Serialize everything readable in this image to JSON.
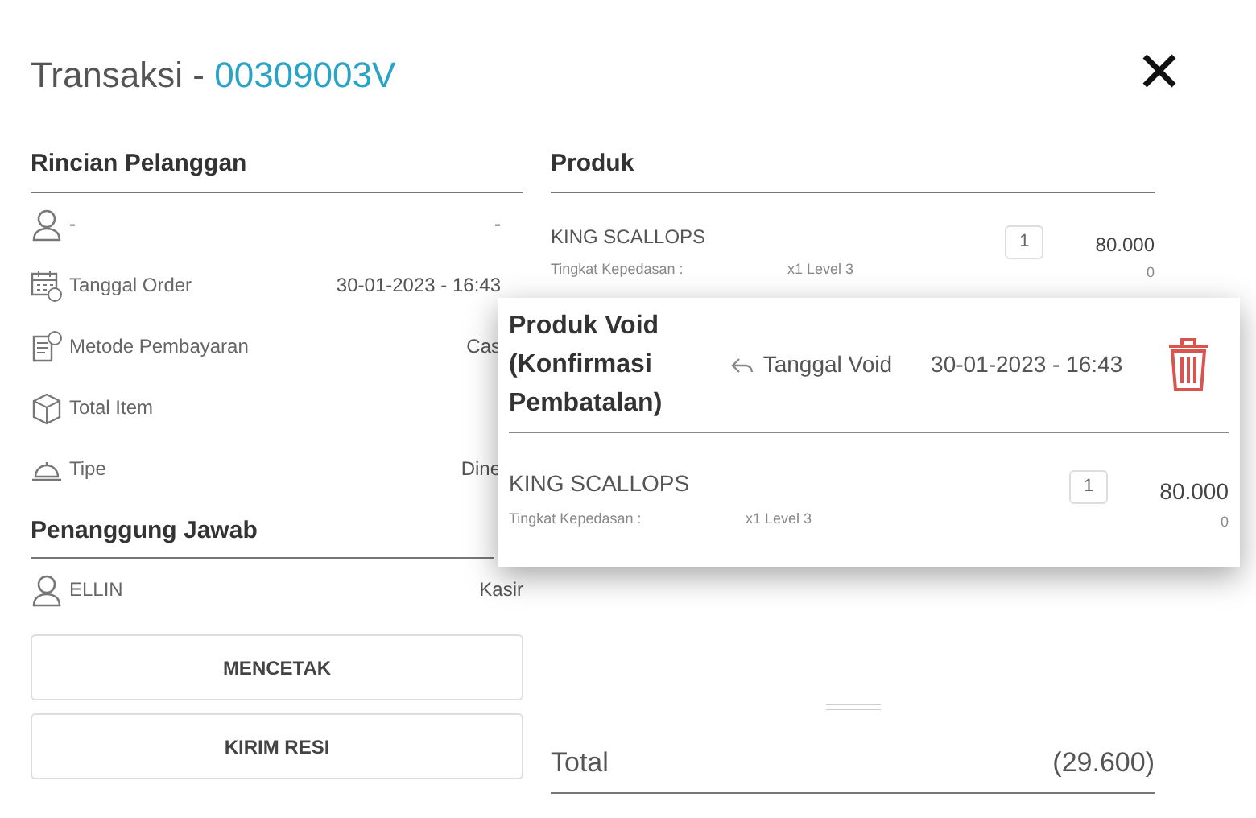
{
  "header": {
    "title": "Transaksi - ",
    "transaction_id": "00309003V"
  },
  "customer_details": {
    "title": "Rincian Pelanggan",
    "rows": [
      {
        "kind": "person",
        "label": "-",
        "value": "-"
      },
      {
        "kind": "calendar",
        "label": "Tanggal Order",
        "value": "30-01-2023 - 16:43"
      },
      {
        "kind": "receipt",
        "label": "Metode Pembayaran",
        "value": "Cas"
      },
      {
        "kind": "box",
        "label": "Total Item"
      },
      {
        "kind": "bell",
        "label": "Tipe",
        "value": "Dine"
      }
    ]
  },
  "responsible": {
    "title": "Penanggung Jawab",
    "rows": [
      {
        "kind": "person",
        "label": "ELLIN",
        "value": "Kasir"
      }
    ]
  },
  "buttons": [
    "MENCETAK",
    "KIRIM RESI"
  ],
  "products": {
    "title": "Produk",
    "items": [
      {
        "name": "KING SCALLOPS",
        "option_label": "Tingkat Kepedasan :",
        "option_value": "x1 Level 3",
        "quantity": "1",
        "price": "80.000",
        "sub": "0"
      }
    ]
  },
  "void_card": {
    "title": "Produk Void (Konfirmasi Pembatalan)",
    "date_label": "Tanggal Void",
    "date": "30-01-2023 - 16:43",
    "items": [
      {
        "name": "KING SCALLOPS",
        "option_label": "Tingkat Kepedasan :",
        "option_value": "x1 Level 3",
        "quantity": "1",
        "price": "80.000",
        "sub": "0"
      }
    ]
  },
  "total": {
    "label": "Total",
    "value": "(29.600)"
  }
}
